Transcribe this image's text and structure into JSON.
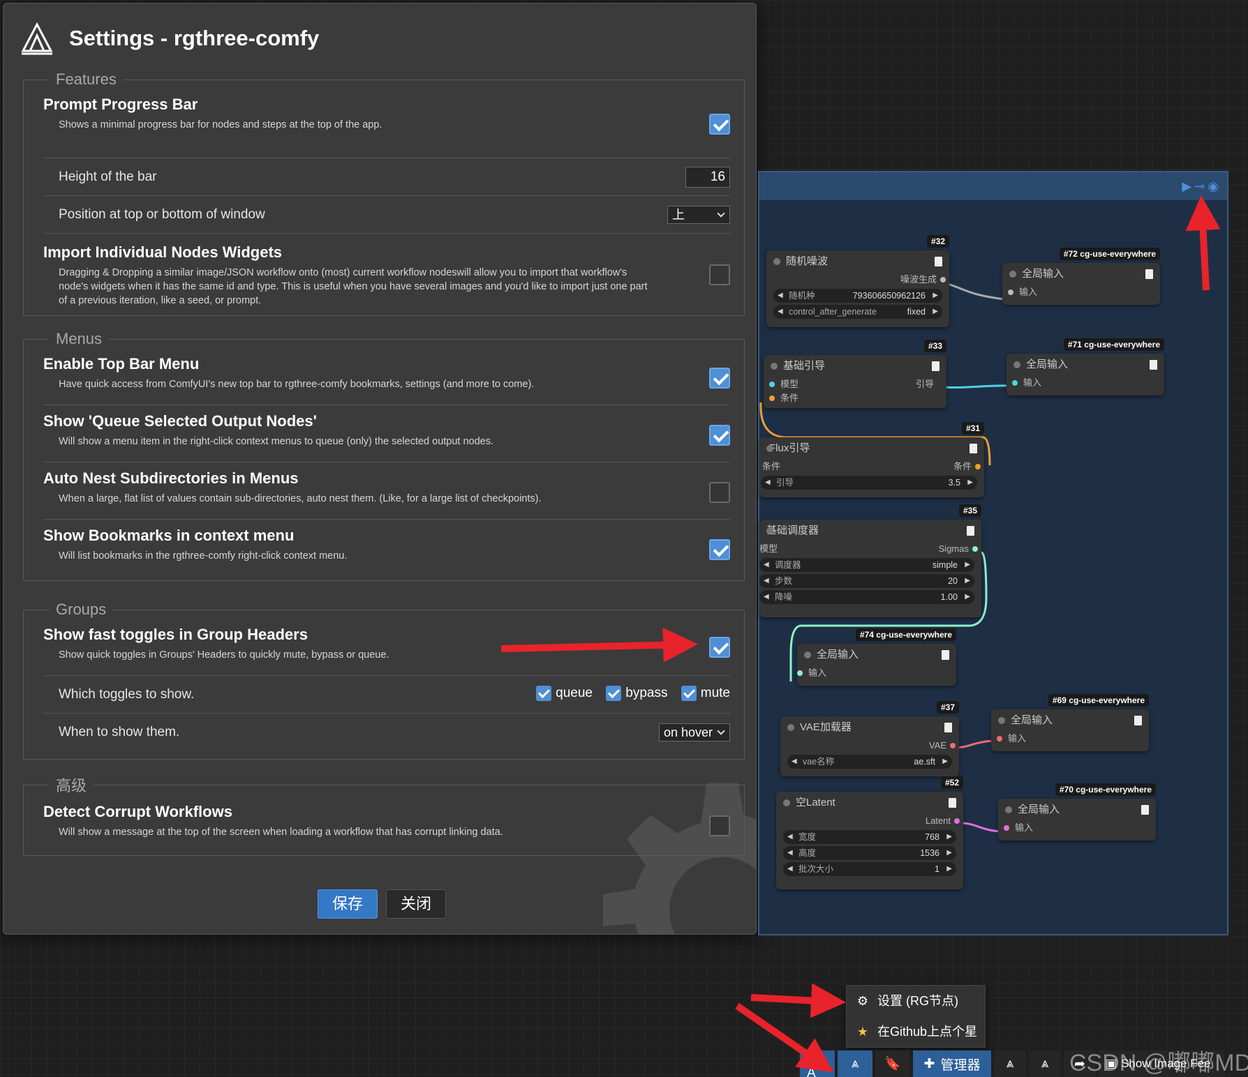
{
  "dialog": {
    "title": "Settings - rgthree-comfy",
    "sections": {
      "features": {
        "legend": "Features",
        "prompt_progress": {
          "title": "Prompt Progress Bar",
          "desc": "Shows a minimal progress bar for nodes and steps at the top of the app.",
          "checked": true
        },
        "height": {
          "label": "Height of the bar",
          "value": "16"
        },
        "position": {
          "label": "Position at top or bottom of window",
          "value": "上"
        },
        "import_widgets": {
          "title": "Import Individual Nodes Widgets",
          "desc": "Dragging & Dropping a similar image/JSON workflow onto (most) current workflow nodeswill allow you to import that workflow's node's widgets when it has the same id and type. This is useful when you have several images and you'd like to import just one part of a previous iteration, like a seed, or prompt.",
          "checked": false
        }
      },
      "menus": {
        "legend": "Menus",
        "top_bar": {
          "title": "Enable Top Bar Menu",
          "desc": "Have quick access from ComfyUI's new top bar to rgthree-comfy bookmarks, settings (and more to come).",
          "checked": true
        },
        "queue_selected": {
          "title": "Show 'Queue Selected Output Nodes'",
          "desc": "Will show a menu item in the right-click context menus to queue (only) the selected output nodes.",
          "checked": true
        },
        "auto_nest": {
          "title": "Auto Nest Subdirectories in Menus",
          "desc": "When a large, flat list of values contain sub-directories, auto nest them. (Like, for a large list of checkpoints).",
          "checked": false
        },
        "bookmarks": {
          "title": "Show Bookmarks in context menu",
          "desc": "Will list bookmarks in the rgthree-comfy right-click context menu.",
          "checked": true
        }
      },
      "groups": {
        "legend": "Groups",
        "fast_toggles": {
          "title": "Show fast toggles in Group Headers",
          "desc": "Show quick toggles in Groups' Headers to quickly mute, bypass or queue.",
          "checked": true
        },
        "which_toggles": {
          "label": "Which toggles to show.",
          "options": [
            "queue",
            "bypass",
            "mute"
          ]
        },
        "when_show": {
          "label": "When to show them.",
          "value": "on hover"
        }
      },
      "advanced": {
        "legend": "高级",
        "detect_corrupt": {
          "title": "Detect Corrupt Workflows",
          "desc": "Will show a message at the top of the screen when loading a workflow that has corrupt linking data.",
          "checked": false
        }
      }
    },
    "buttons": {
      "save": "保存",
      "close": "关闭"
    }
  },
  "canvas": {
    "nodes": {
      "n32": {
        "id": "#32",
        "title": "随机噪波",
        "out": "噪波生成",
        "w1_label": "随机种",
        "w1_value": "793606650962126",
        "w2_label": "control_after_generate",
        "w2_value": "fixed"
      },
      "n72": {
        "id": "#72 cg-use-everywhere",
        "title": "全局输入",
        "in": "输入"
      },
      "n33": {
        "id": "#33",
        "title": "基础引导",
        "in1": "模型",
        "in2": "条件",
        "out": "引导"
      },
      "n71": {
        "id": "#71 cg-use-everywhere",
        "title": "全局输入",
        "in": "输入"
      },
      "n31": {
        "id": "#31",
        "title": "Flux引导",
        "in": "条件",
        "out": "条件",
        "w_label": "引导",
        "w_value": "3.5"
      },
      "n35": {
        "id": "#35",
        "title": "基础调度器",
        "in": "模型",
        "out": "Sigmas",
        "w1_label": "调度器",
        "w1_value": "simple",
        "w2_label": "步数",
        "w2_value": "20",
        "w3_label": "降噪",
        "w3_value": "1.00"
      },
      "n74": {
        "id": "#74 cg-use-everywhere",
        "title": "全局输入",
        "in": "输入"
      },
      "n69": {
        "id": "#69 cg-use-everywhere",
        "title": "全局输入",
        "in": "输入"
      },
      "n37": {
        "id": "#37",
        "title": "VAE加载器",
        "out": "VAE",
        "w_label": "vae名称",
        "w_value": "ae.sft"
      },
      "n52": {
        "id": "#52",
        "title": "空Latent",
        "out": "Latent",
        "w1_label": "宽度",
        "w1_value": "768",
        "w2_label": "高度",
        "w2_value": "1536",
        "w3_label": "批次大小",
        "w3_value": "1"
      },
      "n70": {
        "id": "#70 cg-use-everywhere",
        "title": "全局输入",
        "in": "输入"
      }
    }
  },
  "context_menu": {
    "settings": "设置 (RG节点)",
    "github": "在Github上点个星"
  },
  "bottom_bar": {
    "manager": "管理器",
    "show_image": "Show Image Fee"
  },
  "watermark": "CSDN @嘟嘟MD",
  "colors": {
    "accent": "#4f8fd6",
    "arrow": "#e8232b"
  }
}
